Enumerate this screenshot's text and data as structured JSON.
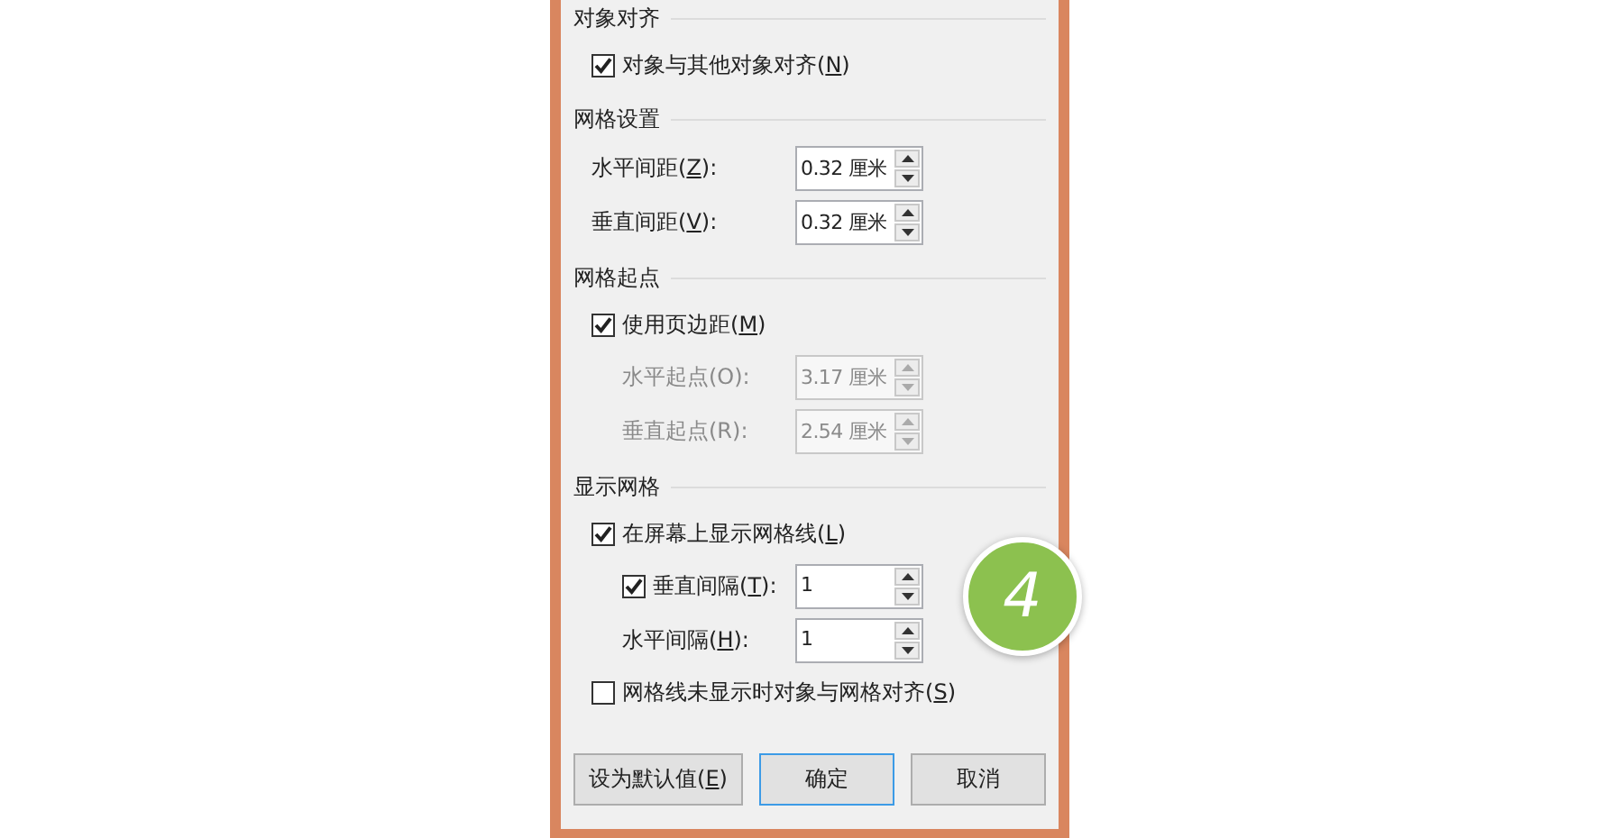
{
  "sections": [
    {
      "heading": "对象对齐",
      "items": [
        {
          "kind": "checkbox",
          "checked": true,
          "label": "对象与其他对象对齐(",
          "key": "N",
          "suffix": ")"
        }
      ]
    },
    {
      "heading": "网格设置",
      "items": [
        {
          "kind": "spin",
          "disabled": false,
          "label": "水平间距(",
          "key": "Z",
          "suffix": "):",
          "value": "0.32 厘米"
        },
        {
          "kind": "spin",
          "disabled": false,
          "label": "垂直间距(",
          "key": "V",
          "suffix": "):",
          "value": "0.32 厘米"
        }
      ]
    },
    {
      "heading": "网格起点",
      "items": [
        {
          "kind": "checkbox",
          "checked": true,
          "label": "使用页边距(",
          "key": "M",
          "suffix": ")",
          "children": [
            {
              "kind": "spin",
              "disabled": true,
              "label": "水平起点(O):",
              "value": "3.17 厘米"
            },
            {
              "kind": "spin",
              "disabled": true,
              "label": "垂直起点(R):",
              "value": "2.54 厘米"
            }
          ]
        }
      ]
    },
    {
      "heading": "显示网格",
      "items": [
        {
          "kind": "checkbox",
          "checked": true,
          "label": "在屏幕上显示网格线(",
          "key": "L",
          "suffix": ")",
          "children": [
            {
              "kind": "checkbox-spin",
              "checked": true,
              "disabled": false,
              "label": "垂直间隔(",
              "key": "T",
              "suffix": "):",
              "value": "1"
            },
            {
              "kind": "spin",
              "disabled": false,
              "label": "水平间隔(",
              "key": "H",
              "suffix": "):",
              "value": "1"
            }
          ]
        },
        {
          "kind": "checkbox",
          "checked": false,
          "label": "网格线未显示时对象与网格对齐(",
          "key": "S",
          "suffix": ")"
        }
      ]
    }
  ],
  "buttons": [
    {
      "label": "设为默认值(",
      "key": "E",
      "suffix": ")",
      "default": false
    },
    {
      "label": "确定",
      "default": true
    },
    {
      "label": "取消",
      "default": false
    }
  ],
  "badge": "4"
}
